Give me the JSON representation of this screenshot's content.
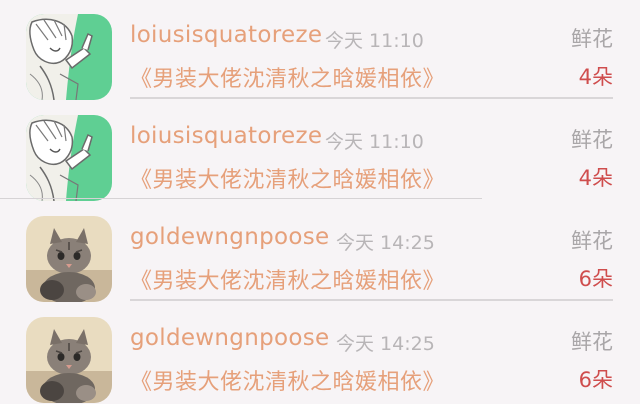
{
  "colors": {
    "accent_orange": "#e6a07a",
    "count_red": "#cf4d4d",
    "muted_gray": "#b8b5b7",
    "avatar_green": "#5fcf93"
  },
  "rows": [
    {
      "avatar": "anime-character-avatar",
      "username": "loiusisquatoreze",
      "timestamp": "今天 11:10",
      "gift_type": "鲜花",
      "book_title": "《男装大佬沈清秋之晗媛相依》",
      "gift_count": "4朵"
    },
    {
      "avatar": "anime-character-avatar",
      "username": "loiusisquatoreze",
      "timestamp": "今天 11:10",
      "gift_type": "鲜花",
      "book_title": "《男装大佬沈清秋之晗媛相依》",
      "gift_count": "4朵"
    },
    {
      "avatar": "cat-photo-avatar",
      "username": "goldewngnpoose",
      "timestamp": "今天 14:25",
      "gift_type": "鲜花",
      "book_title": "《男装大佬沈清秋之晗媛相依》",
      "gift_count": "6朵"
    },
    {
      "avatar": "cat-photo-avatar",
      "username": "goldewngnpoose",
      "timestamp": "今天 14:25",
      "gift_type": "鲜花",
      "book_title": "《男装大佬沈清秋之晗媛相依》",
      "gift_count": "6朵"
    }
  ]
}
